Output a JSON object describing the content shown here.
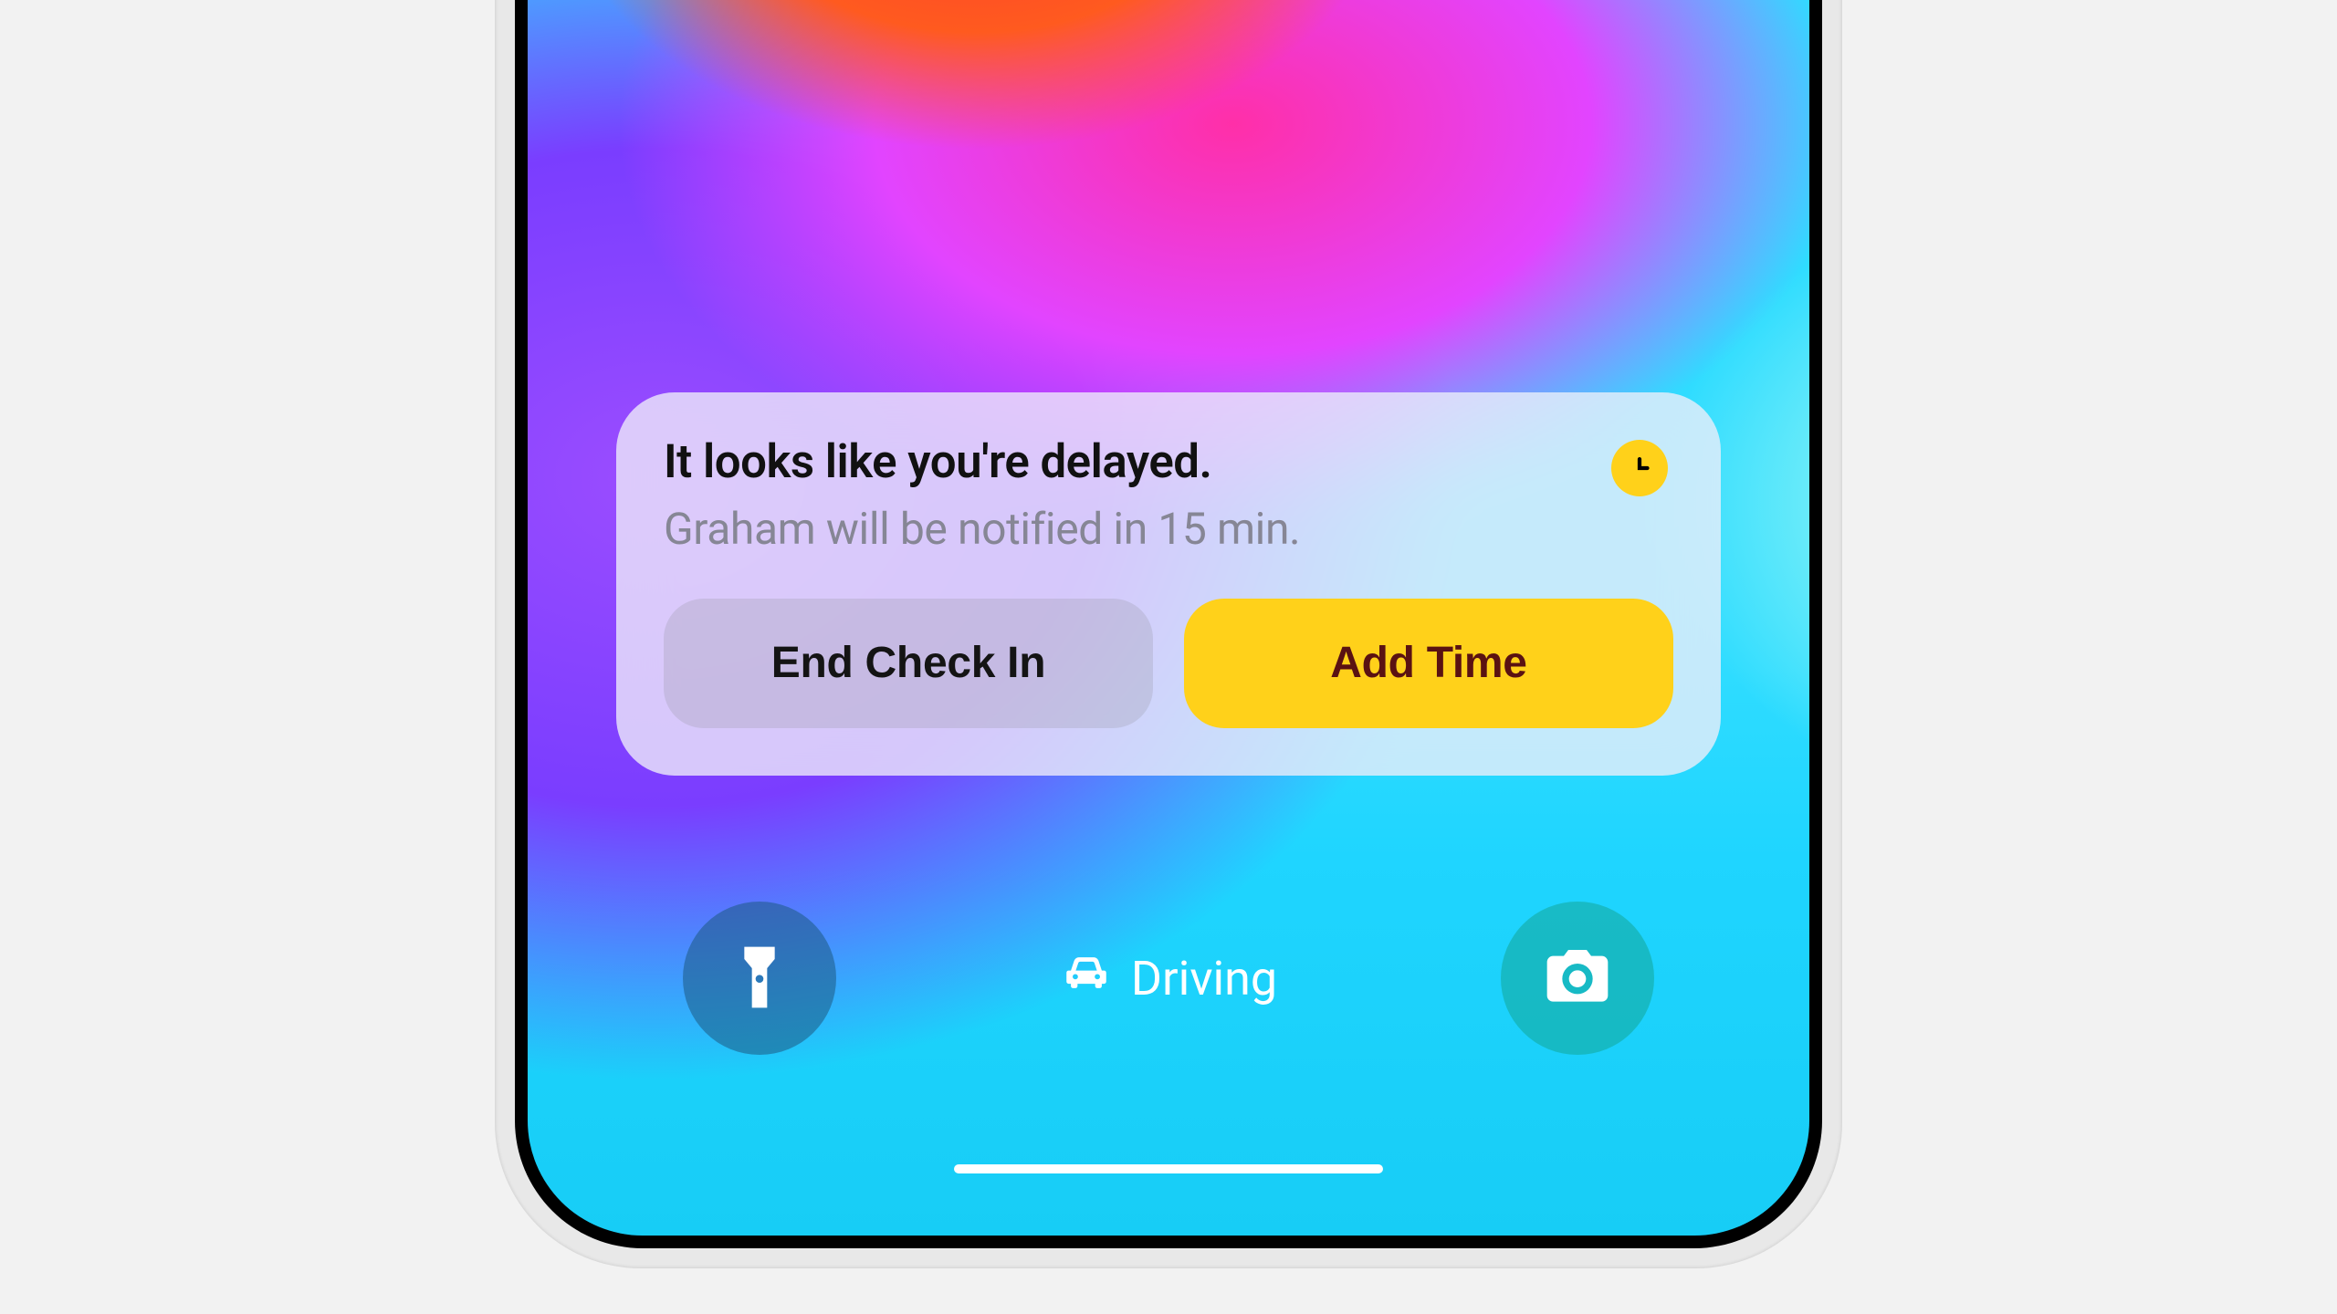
{
  "notification": {
    "title": "It looks like you're delayed.",
    "subtitle": "Graham will be notified in 15 min.",
    "buttons": {
      "end_label": "End Check In",
      "add_label": "Add Time"
    }
  },
  "focus": {
    "label": "Driving"
  },
  "colors": {
    "accent_yellow": "#ffd11a"
  }
}
